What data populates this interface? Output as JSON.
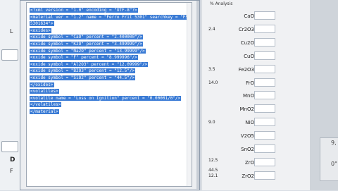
{
  "left_strip": {
    "labels": [
      "L",
      "D",
      "F"
    ]
  },
  "xml_dialog": {
    "lines": [
      "<?xml version = \"1.0\" encoding = \"UTF-8\"?>",
      "<material ver = \"1.2\" name = \"Ferro Frit 5301\" searchkey = \"F5301 Frit",
      "5301634\">",
      "<oxides>",
      "<oxide symbol = \"CaO\" percent = \"2.400000\"/>",
      "<oxide symbol = \"K2O\" percent = \"3.499999\"/>",
      "<oxide symbol = \"Na2O\" percent = \"13.99999\"/>",
      "<oxide symbol = \"F\" percent = \"8.999996\"/>",
      "<oxide symbol = \"Al2O3\" percent = \"12.09999\"/>",
      "<oxide symbol = \"B2O3\" percent = \"12.5\"/>",
      "<oxide symbol = \"SiO2\" percent = \"44.5\"/>",
      "</oxides>",
      "<volatiles>",
      "<volatile name = \"Loss on Ignition\" percent = \"0.00001/0\"/>",
      "</volatiles>",
      "</material>"
    ]
  },
  "analysis_panel": {
    "title": "% Analysis",
    "rows": [
      {
        "value": "",
        "symbol": "CaO"
      },
      {
        "value": "2.4",
        "symbol": "Cr2O3"
      },
      {
        "value": "",
        "symbol": "Cu2O"
      },
      {
        "value": "",
        "symbol": "CuO"
      },
      {
        "value": "3.5",
        "symbol": "Fe2O3"
      },
      {
        "value": "14.0",
        "symbol": "FrO"
      },
      {
        "value": "",
        "symbol": "MnO"
      },
      {
        "value": "",
        "symbol": "MnO2"
      },
      {
        "value": "9.0",
        "symbol": "NiO"
      },
      {
        "value": "",
        "symbol": "V2O5"
      },
      {
        "value": "",
        "symbol": "SnO2"
      },
      {
        "value": "",
        "symbol": "ZrO"
      },
      {
        "value": "12.1",
        "symbol": "ZrO2"
      }
    ],
    "extra_values": [
      "12.5",
      "44.5"
    ]
  },
  "right_background": {
    "edge_texts": [
      "9,",
      "0\""
    ]
  }
}
